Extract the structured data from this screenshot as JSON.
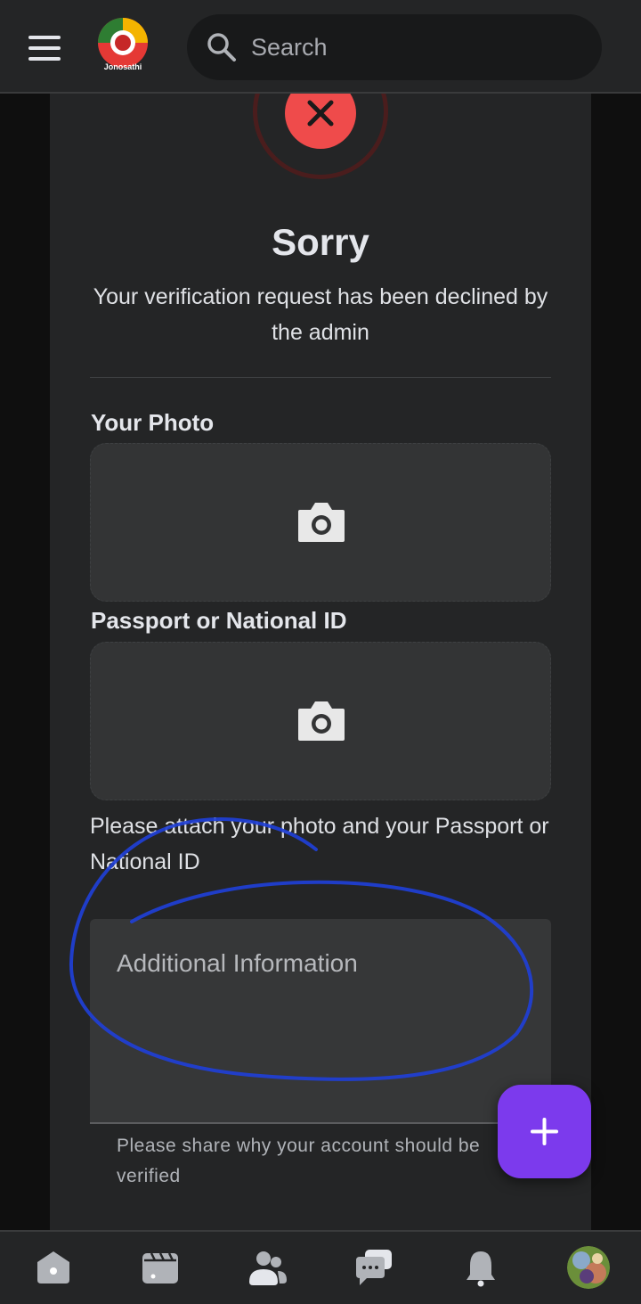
{
  "header": {
    "brand_name": "Jonosathi",
    "search_placeholder": "Search"
  },
  "status": {
    "title": "Sorry",
    "message": "Your verification request has been declined by the admin",
    "color": "#ef4b4b"
  },
  "form": {
    "photo_label": "Your Photo",
    "id_label": "Passport or National ID",
    "attach_hint": "Please attach your photo and your Passport or National ID",
    "additional_placeholder": "Additional Information",
    "additional_helper": "Please share why your account should be verified"
  },
  "fab": {
    "icon": "plus-icon",
    "color": "#7c3aed"
  },
  "bottom_nav": [
    {
      "icon": "home-icon"
    },
    {
      "icon": "video-icon"
    },
    {
      "icon": "friends-icon"
    },
    {
      "icon": "chat-icon"
    },
    {
      "icon": "bell-icon"
    },
    {
      "icon": "profile-avatar"
    }
  ],
  "annotation_color": "#1f3fd6"
}
